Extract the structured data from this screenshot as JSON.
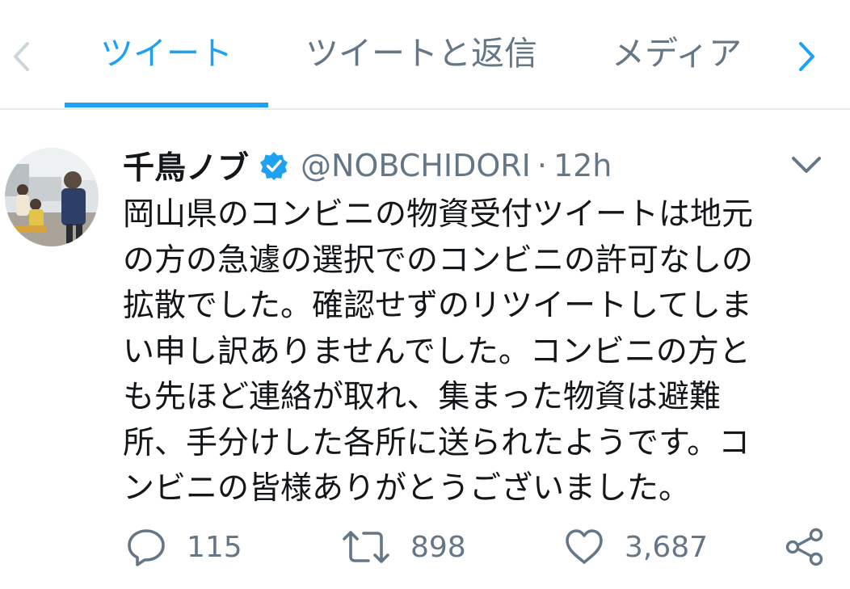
{
  "tabs": [
    {
      "label": "ツイート",
      "active": true
    },
    {
      "label": "ツイートと返信",
      "active": false
    },
    {
      "label": "メディア",
      "active": false
    }
  ],
  "tab_nav": {
    "left_icon": "chevron-left-icon",
    "right_icon": "chevron-right-icon"
  },
  "tweet": {
    "display_name": "千鳥ノブ",
    "verified_icon": "verified-badge-icon",
    "handle": "@NOBCHIDORI",
    "separator": "·",
    "time": "12h",
    "menu_icon": "chevron-down-icon",
    "text_lines": [
      "岡山県のコンビニの物資受付ツイートは地元",
      "の方の急遽の選択でのコンビニの許可なしの",
      "拡散でした。確認せずのリツイートしてしま",
      "い申し訳ありませんでした。コンビニの方と",
      "も先ほど連絡が取れ、集まった物資は避難",
      "所、手分けした各所に送られたようです。コ",
      "ンビニの皆様ありがとうございました。"
    ]
  },
  "actions": {
    "reply": {
      "icon": "reply-icon",
      "count": "115"
    },
    "retweet": {
      "icon": "retweet-icon",
      "count": "898"
    },
    "like": {
      "icon": "heart-icon",
      "count": "3,687"
    },
    "share": {
      "icon": "share-icon"
    }
  },
  "colors": {
    "accent": "#1da1f2",
    "muted": "#657786",
    "text": "#14171a",
    "divider": "#e6ecf0"
  }
}
